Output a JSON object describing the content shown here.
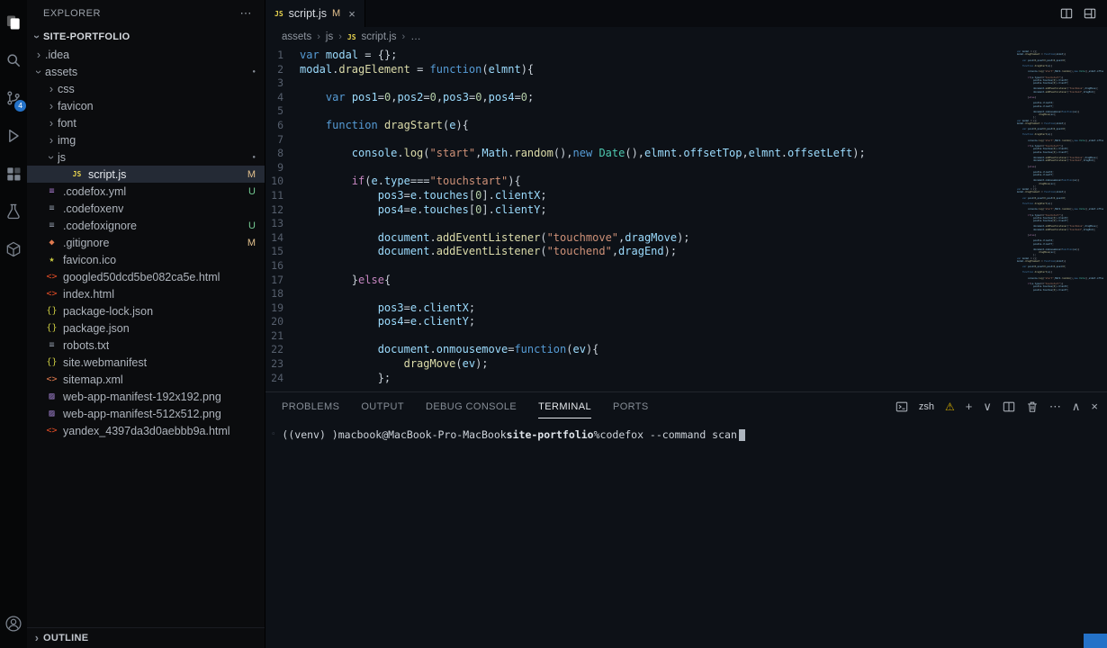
{
  "activity_bar": {
    "top": [
      {
        "name": "files-icon",
        "icon": "files",
        "active": true
      },
      {
        "name": "search-icon",
        "icon": "search"
      },
      {
        "name": "source-control-icon",
        "icon": "scm",
        "badge": "4"
      },
      {
        "name": "run-debug-icon",
        "icon": "debug"
      },
      {
        "name": "extensions-icon",
        "icon": "ext"
      },
      {
        "name": "testing-icon",
        "icon": "flask"
      },
      {
        "name": "package-icon",
        "icon": "box"
      }
    ],
    "bottom": [
      {
        "name": "account-icon",
        "icon": "account"
      }
    ]
  },
  "sidebar": {
    "header": {
      "title": "EXPLORER",
      "more": "⋯"
    },
    "section": {
      "label": "SITE-PORTFOLIO"
    },
    "tree": [
      {
        "label": ".idea",
        "kind": "folder",
        "indent": 0,
        "expanded": false
      },
      {
        "label": "assets",
        "kind": "folder",
        "indent": 0,
        "expanded": true,
        "dot": true
      },
      {
        "label": "css",
        "kind": "folder",
        "indent": 1,
        "expanded": false
      },
      {
        "label": "favicon",
        "kind": "folder",
        "indent": 1,
        "expanded": false
      },
      {
        "label": "font",
        "kind": "folder",
        "indent": 1,
        "expanded": false
      },
      {
        "label": "img",
        "kind": "folder",
        "indent": 1,
        "expanded": false
      },
      {
        "label": "js",
        "kind": "folder",
        "indent": 1,
        "expanded": true,
        "dot": true
      },
      {
        "label": "script.js",
        "kind": "file",
        "ftype": "js",
        "indent": 2,
        "badge": "M",
        "selected": true
      },
      {
        "label": ".codefox.yml",
        "kind": "file",
        "ftype": "yml",
        "indent": 0,
        "badge": "U"
      },
      {
        "label": ".codefoxenv",
        "kind": "file",
        "ftype": "txt",
        "indent": 0
      },
      {
        "label": ".codefoxignore",
        "kind": "file",
        "ftype": "ignore",
        "indent": 0,
        "badge": "U"
      },
      {
        "label": ".gitignore",
        "kind": "file",
        "ftype": "git",
        "indent": 0,
        "badge": "M"
      },
      {
        "label": "favicon.ico",
        "kind": "file",
        "ftype": "star",
        "indent": 0
      },
      {
        "label": "googled50dcd5be082ca5e.html",
        "kind": "file",
        "ftype": "html",
        "indent": 0
      },
      {
        "label": "index.html",
        "kind": "file",
        "ftype": "html",
        "indent": 0
      },
      {
        "label": "package-lock.json",
        "kind": "file",
        "ftype": "json",
        "indent": 0
      },
      {
        "label": "package.json",
        "kind": "file",
        "ftype": "json",
        "indent": 0
      },
      {
        "label": "robots.txt",
        "kind": "file",
        "ftype": "txt",
        "indent": 0
      },
      {
        "label": "site.webmanifest",
        "kind": "file",
        "ftype": "json",
        "indent": 0
      },
      {
        "label": "sitemap.xml",
        "kind": "file",
        "ftype": "xml",
        "indent": 0
      },
      {
        "label": "web-app-manifest-192x192.png",
        "kind": "file",
        "ftype": "image",
        "indent": 0
      },
      {
        "label": "web-app-manifest-512x512.png",
        "kind": "file",
        "ftype": "image",
        "indent": 0
      },
      {
        "label": "yandex_4397da3d0aebbb9a.html",
        "kind": "file",
        "ftype": "html",
        "indent": 0
      }
    ],
    "outline": {
      "label": "OUTLINE"
    }
  },
  "editor": {
    "tabs": [
      {
        "label": "script.js",
        "icon": "js",
        "git_badge": "M",
        "close": "×",
        "active": true
      }
    ],
    "breadcrumbs": [
      {
        "label": "assets"
      },
      {
        "label": "js"
      },
      {
        "label": "script.js",
        "icon": "js"
      },
      {
        "label": "…"
      }
    ],
    "code_lines": [
      [
        [
          "k",
          "var"
        ],
        [
          "p",
          " "
        ],
        [
          "v",
          "modal"
        ],
        [
          "p",
          " = {};"
        ]
      ],
      [
        [
          "v",
          "modal"
        ],
        [
          "p",
          "."
        ],
        [
          "f",
          "dragElement"
        ],
        [
          "p",
          " = "
        ],
        [
          "k",
          "function"
        ],
        [
          "p",
          "("
        ],
        [
          "v",
          "elmnt"
        ],
        [
          "p",
          "){"
        ]
      ],
      [],
      [
        [
          "p",
          "    "
        ],
        [
          "k",
          "var"
        ],
        [
          "p",
          " "
        ],
        [
          "v",
          "pos1"
        ],
        [
          "p",
          "="
        ],
        [
          "n",
          "0"
        ],
        [
          "p",
          ","
        ],
        [
          "v",
          "pos2"
        ],
        [
          "p",
          "="
        ],
        [
          "n",
          "0"
        ],
        [
          "p",
          ","
        ],
        [
          "v",
          "pos3"
        ],
        [
          "p",
          "="
        ],
        [
          "n",
          "0"
        ],
        [
          "p",
          ","
        ],
        [
          "v",
          "pos4"
        ],
        [
          "p",
          "="
        ],
        [
          "n",
          "0"
        ],
        [
          "p",
          ";"
        ]
      ],
      [],
      [
        [
          "p",
          "    "
        ],
        [
          "k",
          "function"
        ],
        [
          "p",
          " "
        ],
        [
          "f",
          "dragStart"
        ],
        [
          "p",
          "("
        ],
        [
          "v",
          "e"
        ],
        [
          "p",
          "){"
        ]
      ],
      [],
      [
        [
          "p",
          "        "
        ],
        [
          "v",
          "console"
        ],
        [
          "p",
          "."
        ],
        [
          "f",
          "log"
        ],
        [
          "p",
          "("
        ],
        [
          "s",
          "\"start\""
        ],
        [
          "p",
          ","
        ],
        [
          "v",
          "Math"
        ],
        [
          "p",
          "."
        ],
        [
          "f",
          "random"
        ],
        [
          "p",
          "(),"
        ],
        [
          "k",
          "new"
        ],
        [
          "p",
          " "
        ],
        [
          "c",
          "Date"
        ],
        [
          "p",
          "(),"
        ],
        [
          "v",
          "elmnt"
        ],
        [
          "p",
          "."
        ],
        [
          "v",
          "offsetTop"
        ],
        [
          "p",
          ","
        ],
        [
          "v",
          "elmnt"
        ],
        [
          "p",
          "."
        ],
        [
          "v",
          "offsetLeft"
        ],
        [
          "p",
          ");"
        ]
      ],
      [],
      [
        [
          "p",
          "        "
        ],
        [
          "ck",
          "if"
        ],
        [
          "p",
          "("
        ],
        [
          "v",
          "e"
        ],
        [
          "p",
          "."
        ],
        [
          "v",
          "type"
        ],
        [
          "p",
          "==="
        ],
        [
          "s",
          "\"touchstart\""
        ],
        [
          "p",
          "){"
        ]
      ],
      [
        [
          "p",
          "            "
        ],
        [
          "v",
          "pos3"
        ],
        [
          "p",
          "="
        ],
        [
          "v",
          "e"
        ],
        [
          "p",
          "."
        ],
        [
          "v",
          "touches"
        ],
        [
          "p",
          "["
        ],
        [
          "n",
          "0"
        ],
        [
          "p",
          "]."
        ],
        [
          "v",
          "clientX"
        ],
        [
          "p",
          ";"
        ]
      ],
      [
        [
          "p",
          "            "
        ],
        [
          "v",
          "pos4"
        ],
        [
          "p",
          "="
        ],
        [
          "v",
          "e"
        ],
        [
          "p",
          "."
        ],
        [
          "v",
          "touches"
        ],
        [
          "p",
          "["
        ],
        [
          "n",
          "0"
        ],
        [
          "p",
          "]."
        ],
        [
          "v",
          "clientY"
        ],
        [
          "p",
          ";"
        ]
      ],
      [],
      [
        [
          "p",
          "            "
        ],
        [
          "v",
          "document"
        ],
        [
          "p",
          "."
        ],
        [
          "f",
          "addEventListener"
        ],
        [
          "p",
          "("
        ],
        [
          "s",
          "\"touchmove\""
        ],
        [
          "p",
          ","
        ],
        [
          "v",
          "dragMove"
        ],
        [
          "p",
          ");"
        ]
      ],
      [
        [
          "p",
          "            "
        ],
        [
          "v",
          "document"
        ],
        [
          "p",
          "."
        ],
        [
          "f",
          "addEventListener"
        ],
        [
          "p",
          "("
        ],
        [
          "s",
          "\"touchend\""
        ],
        [
          "p",
          ","
        ],
        [
          "v",
          "dragEnd"
        ],
        [
          "p",
          ");"
        ]
      ],
      [],
      [
        [
          "p",
          "        }"
        ],
        [
          "ck",
          "else"
        ],
        [
          "p",
          "{"
        ]
      ],
      [],
      [
        [
          "p",
          "            "
        ],
        [
          "v",
          "pos3"
        ],
        [
          "p",
          "="
        ],
        [
          "v",
          "e"
        ],
        [
          "p",
          "."
        ],
        [
          "v",
          "clientX"
        ],
        [
          "p",
          ";"
        ]
      ],
      [
        [
          "p",
          "            "
        ],
        [
          "v",
          "pos4"
        ],
        [
          "p",
          "="
        ],
        [
          "v",
          "e"
        ],
        [
          "p",
          "."
        ],
        [
          "v",
          "clientY"
        ],
        [
          "p",
          ";"
        ]
      ],
      [],
      [
        [
          "p",
          "            "
        ],
        [
          "v",
          "document"
        ],
        [
          "p",
          "."
        ],
        [
          "v",
          "onmousemove"
        ],
        [
          "p",
          "="
        ],
        [
          "k",
          "function"
        ],
        [
          "p",
          "("
        ],
        [
          "v",
          "ev"
        ],
        [
          "p",
          "){"
        ]
      ],
      [
        [
          "p",
          "                "
        ],
        [
          "f",
          "dragMove"
        ],
        [
          "p",
          "("
        ],
        [
          "v",
          "ev"
        ],
        [
          "p",
          ");"
        ]
      ],
      [
        [
          "p",
          "            };"
        ]
      ]
    ]
  },
  "editor_actions": [
    {
      "name": "split-editor-icon",
      "icon": "splitEditor"
    },
    {
      "name": "editor-layout-icon",
      "icon": "layout"
    }
  ],
  "panel": {
    "tabs": [
      {
        "label": "PROBLEMS"
      },
      {
        "label": "OUTPUT"
      },
      {
        "label": "DEBUG CONSOLE"
      },
      {
        "label": "TERMINAL",
        "active": true
      },
      {
        "label": "PORTS"
      }
    ],
    "actions": [
      {
        "name": "terminal-profile-icon",
        "icon": "term"
      },
      {
        "name": "shell-name",
        "label": "zsh"
      },
      {
        "name": "warning-icon",
        "glyph": "⚠",
        "warn": true
      },
      {
        "name": "new-terminal-icon",
        "glyph": "+"
      },
      {
        "name": "terminal-dropdown-icon",
        "glyph": "∨"
      },
      {
        "name": "split-terminal-icon",
        "icon": "split"
      },
      {
        "name": "kill-terminal-icon",
        "icon": "trash"
      },
      {
        "name": "more-actions-icon",
        "glyph": "⋯"
      },
      {
        "name": "maximize-panel-icon",
        "glyph": "∧"
      },
      {
        "name": "close-panel-icon",
        "glyph": "×"
      }
    ],
    "terminal": {
      "decoration": "◦",
      "segments": [
        {
          "text": "((venv) )",
          "cls": "t-plain"
        },
        {
          "text": "macbook@MacBook-Pro-MacBook",
          "cls": "t-plain"
        },
        {
          "text": "site-portfolio",
          "cls": "t-cwd"
        },
        {
          "text": "%",
          "cls": "t-plain"
        },
        {
          "text": "codefox --command scan",
          "cls": "t-plain"
        }
      ],
      "cursor": true
    }
  },
  "colors": {
    "accent": "#2472c8",
    "badge_modified": "#e2c08d",
    "badge_untracked": "#73c991"
  }
}
